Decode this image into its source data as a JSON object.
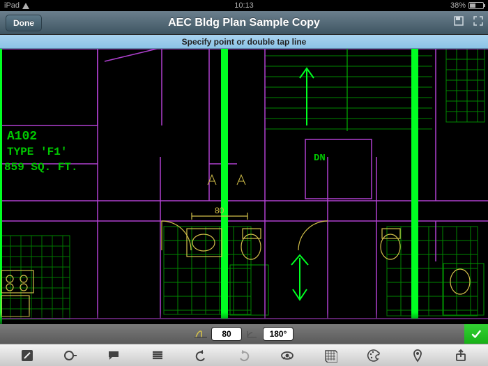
{
  "status_bar": {
    "device": "iPad",
    "time": "10:13",
    "battery_pct": "38%"
  },
  "title": "AEC Bldg Plan Sample Copy",
  "done_label": "Done",
  "prompt": "Specify point or double tap line",
  "drawing": {
    "label_lines": [
      "A102",
      "TYPE 'F1'",
      "859 SQ. FT."
    ],
    "stair_label": "DN",
    "dim_label": "80"
  },
  "input_bar": {
    "distance": "80",
    "angle": "180°"
  },
  "colors": {
    "wall": "#aa33cc",
    "grid": "#00aa00",
    "highlight": "#00ff22",
    "fixture": "#d3c04a",
    "arrow": "#00ff22"
  }
}
